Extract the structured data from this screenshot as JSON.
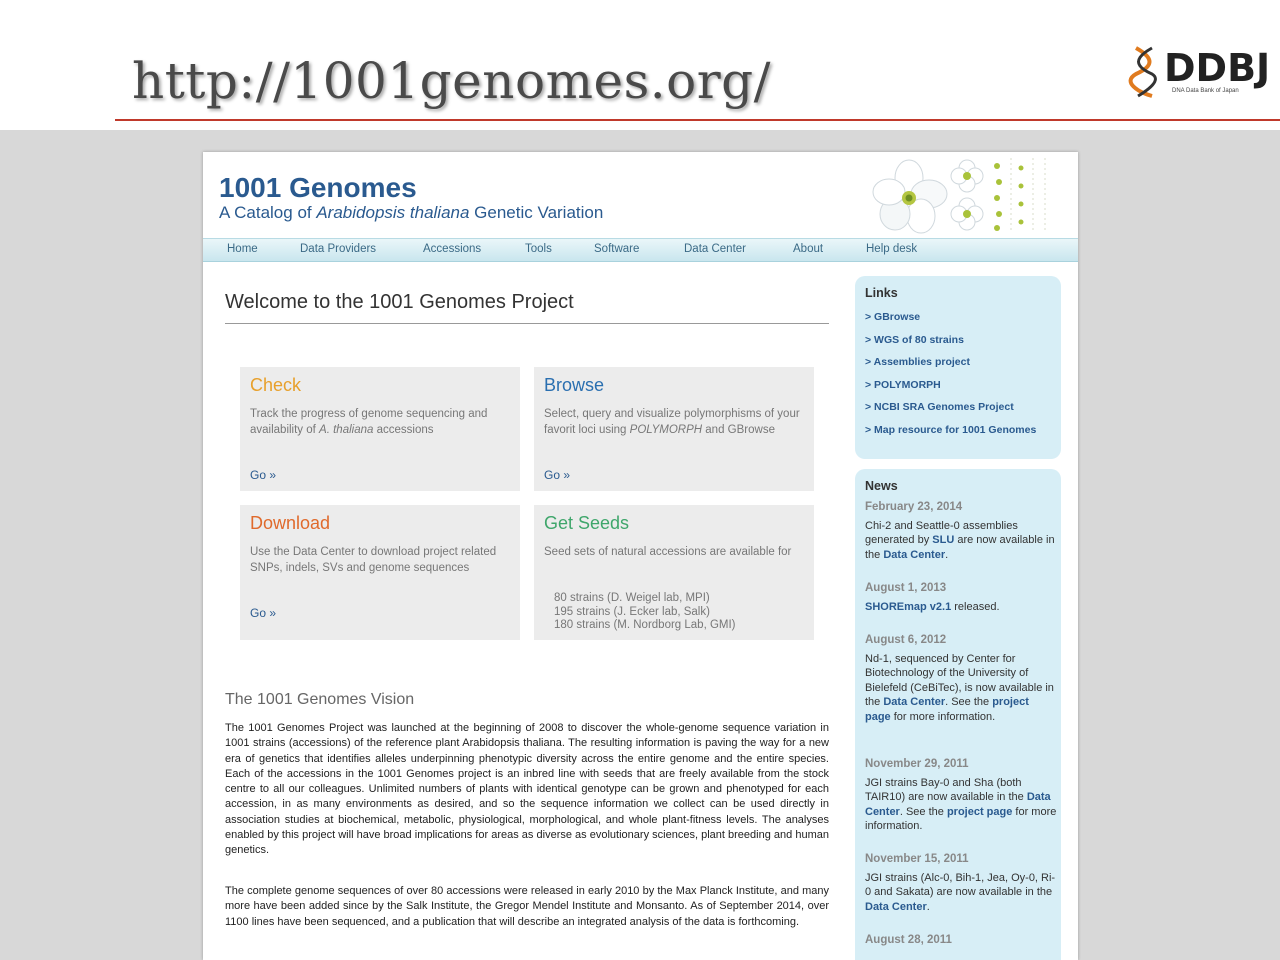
{
  "slide": {
    "url_title": "http://1001genomes.org/",
    "logo_text": "DDBJ",
    "logo_sub": "DNA Data Bank of Japan"
  },
  "site": {
    "title": "1001 Genomes",
    "subtitle_prefix": "A Catalog of ",
    "subtitle_species": "Arabidopsis thaliana",
    "subtitle_suffix": " Genetic Variation"
  },
  "nav": [
    {
      "label": "Home"
    },
    {
      "label": "Data Providers"
    },
    {
      "label": "Accessions"
    },
    {
      "label": "Tools"
    },
    {
      "label": "Software"
    },
    {
      "label": "Data Center"
    },
    {
      "label": "About"
    },
    {
      "label": "Help desk"
    }
  ],
  "welcome": "Welcome to the 1001 Genomes Project",
  "boxes": {
    "check": {
      "title": "Check",
      "desc_a": "Track the progress of genome sequencing and availability of ",
      "desc_em": "A. thaliana",
      "desc_b": " accessions",
      "go": "Go »",
      "color": "#e8a02b"
    },
    "browse": {
      "title": "Browse",
      "desc_a": "Select, query and visualize polymorphisms of your favorit loci using ",
      "desc_em": "POLYMORPH",
      "desc_b": " and GBrowse",
      "go": "Go »",
      "color": "#2a6fb0"
    },
    "download": {
      "title": "Download",
      "desc": "Use the Data Center to download project related SNPs, indels, SVs and genome sequences",
      "go": "Go »",
      "color": "#e06a2c"
    },
    "seeds": {
      "title": "Get Seeds",
      "desc": "Seed sets of natural accessions are available for",
      "list": [
        "80 strains (D. Weigel lab, MPI)",
        "195 strains (J. Ecker lab, Salk)",
        "180 strains (M. Nordborg Lab, GMI)"
      ],
      "color": "#3fa66b"
    }
  },
  "vision": {
    "title": "The 1001 Genomes Vision",
    "p1": "The 1001 Genomes Project was launched at the beginning of 2008 to discover the whole-genome sequence variation in 1001 strains (accessions) of the reference plant Arabidopsis thaliana. The resulting information is paving the way for a new era of genetics that identifies alleles underpinning phenotypic diversity across the entire genome and the entire species. Each of the accessions in the 1001 Genomes project is an inbred line with seeds that are freely available from the stock centre to all our colleagues. Unlimited numbers of plants with identical genotype can be grown and phenotyped for each accession, in as many environments as desired, and so the sequence information we collect can be used directly in association studies at biochemical, metabolic, physiological, morphological, and whole plant-fitness levels. The analyses enabled by this project will have broad implications for areas as diverse as evolutionary sciences, plant breeding and human genetics.",
    "p2": "The complete genome sequences of over 80 accessions were released in early 2010 by the Max Planck Institute, and many more have been added since by the Salk Institute, the Gregor Mendel Institute and Monsanto. As of September 2014, over 1100 lines have been sequenced, and a publication that will describe an integrated analysis of the data is forthcoming."
  },
  "links": {
    "heading": "Links",
    "items": [
      "> GBrowse",
      "> WGS of 80 strains",
      "> Assemblies project",
      "> POLYMORPH",
      "> NCBI SRA Genomes Project",
      "> Map resource for 1001 Genomes"
    ]
  },
  "news": {
    "heading": "News",
    "items": [
      {
        "date": "February 23, 2014",
        "t1": "Chi-2 and Seattle-0 assemblies generated by ",
        "l1": "SLU",
        "t2": " are now available in the ",
        "l2": "Data Center",
        "t3": "."
      },
      {
        "date": "August 1, 2013",
        "t1": "",
        "l1": "SHOREmap v2.1",
        "t2": " released.",
        "l2": "",
        "t3": ""
      },
      {
        "date": "August 6, 2012",
        "t1": "Nd-1, sequenced by Center for Biotechnology of the University of Bielefeld (CeBiTec), is now available in the ",
        "l1": "Data Center",
        "t2": ". See the ",
        "l2": "project page",
        "t3": " for more information."
      },
      {
        "date": "November 29, 2011",
        "t1": "JGI strains Bay-0 and Sha (both TAIR10) are now available in the ",
        "l1": "Data Center",
        "t2": ". See the ",
        "l2": "project page",
        "t3": " for more information."
      },
      {
        "date": "November 15, 2011",
        "t1": "JGI strains (Alc-0, Bih-1, Jea, Oy-0, Ri-0 and Sakata) are now available in the ",
        "l1": "Data Center",
        "t2": ".",
        "l2": "",
        "t3": ""
      },
      {
        "date": "August 28, 2011",
        "t1": "",
        "l1": "",
        "t2": "",
        "l2": "",
        "t3": ""
      }
    ]
  }
}
